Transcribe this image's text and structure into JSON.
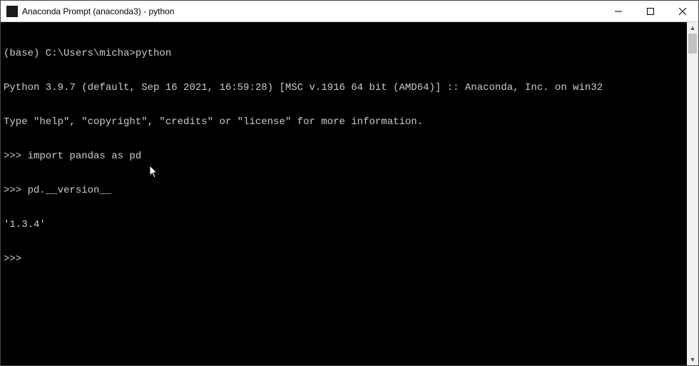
{
  "window": {
    "title": "Anaconda Prompt (anaconda3) - python"
  },
  "terminal": {
    "lines": [
      "(base) C:\\Users\\micha>python",
      "Python 3.9.7 (default, Sep 16 2021, 16:59:28) [MSC v.1916 64 bit (AMD64)] :: Anaconda, Inc. on win32",
      "Type \"help\", \"copyright\", \"credits\" or \"license\" for more information.",
      ">>> import pandas as pd",
      ">>> pd.__version__",
      "'1.3.4'",
      ">>> "
    ]
  }
}
